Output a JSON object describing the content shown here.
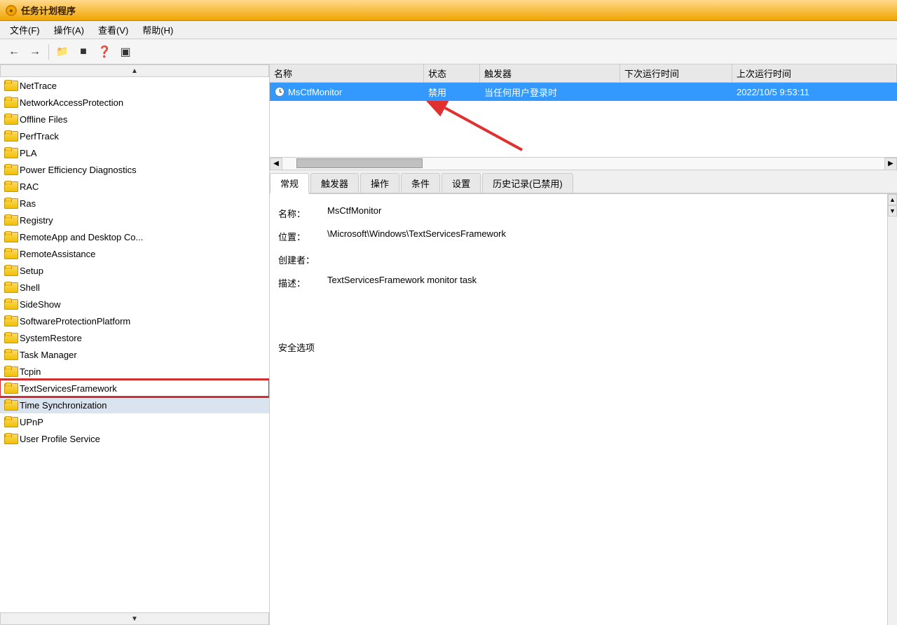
{
  "titleBar": {
    "icon": "●",
    "title": "任务计划程序"
  },
  "menuBar": {
    "items": [
      "文件(F)",
      "操作(A)",
      "查看(V)",
      "帮助(H)"
    ]
  },
  "toolbar": {
    "buttons": [
      "←",
      "→",
      "📁",
      "▣",
      "❓",
      "▣"
    ]
  },
  "sidebar": {
    "items": [
      {
        "label": "NetTrace",
        "selected": false,
        "highlighted": false
      },
      {
        "label": "NetworkAccessProtection",
        "selected": false,
        "highlighted": false
      },
      {
        "label": "Offline Files",
        "selected": false,
        "highlighted": false
      },
      {
        "label": "PerfTrack",
        "selected": false,
        "highlighted": false
      },
      {
        "label": "PLA",
        "selected": false,
        "highlighted": false
      },
      {
        "label": "Power Efficiency Diagnostics",
        "selected": false,
        "highlighted": false
      },
      {
        "label": "RAC",
        "selected": false,
        "highlighted": false
      },
      {
        "label": "Ras",
        "selected": false,
        "highlighted": false
      },
      {
        "label": "Registry",
        "selected": false,
        "highlighted": false
      },
      {
        "label": "RemoteApp and Desktop Co...",
        "selected": false,
        "highlighted": false
      },
      {
        "label": "RemoteAssistance",
        "selected": false,
        "highlighted": false
      },
      {
        "label": "Setup",
        "selected": false,
        "highlighted": false
      },
      {
        "label": "Shell",
        "selected": false,
        "highlighted": false
      },
      {
        "label": "SideShow",
        "selected": false,
        "highlighted": false
      },
      {
        "label": "SoftwareProtectionPlatform",
        "selected": false,
        "highlighted": false
      },
      {
        "label": "SystemRestore",
        "selected": false,
        "highlighted": false
      },
      {
        "label": "Task Manager",
        "selected": false,
        "highlighted": false
      },
      {
        "label": "Tcpin",
        "selected": false,
        "highlighted": false
      },
      {
        "label": "TextServicesFramework",
        "selected": true,
        "highlighted": true
      },
      {
        "label": "Time Synchronization",
        "selected": false,
        "highlighted": false
      },
      {
        "label": "UPnP",
        "selected": false,
        "highlighted": false
      },
      {
        "label": "User Profile Service",
        "selected": false,
        "highlighted": false
      }
    ]
  },
  "taskList": {
    "headers": [
      "名称",
      "状态",
      "触发器",
      "下次运行时间",
      "上次运行时间"
    ],
    "rows": [
      {
        "name": "MsCtfMonitor",
        "status": "禁用",
        "trigger": "当任何用户登录时",
        "nextRun": "",
        "lastRun": "2022/10/5 9:53:11",
        "selected": true
      }
    ]
  },
  "tabs": {
    "items": [
      "常规",
      "触发器",
      "操作",
      "条件",
      "设置",
      "历史记录(已禁用)"
    ],
    "active": 0
  },
  "detail": {
    "fields": [
      {
        "label": "名称：",
        "value": "MsCtfMonitor"
      },
      {
        "label": "位置：",
        "value": "\\Microsoft\\Windows\\TextServicesFramework"
      },
      {
        "label": "创建者：",
        "value": ""
      },
      {
        "label": "描述：",
        "value": "TextServicesFramework monitor task"
      }
    ],
    "footerLabel": "安全选项"
  }
}
